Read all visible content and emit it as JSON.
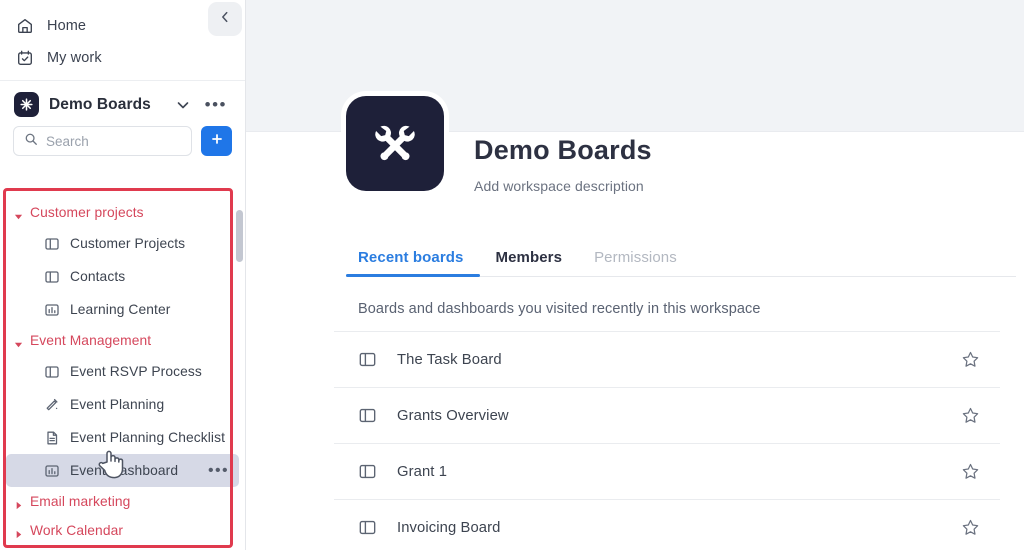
{
  "sidebar": {
    "collapse_label": "chevron-left",
    "nav": [
      {
        "label": "Home",
        "icon": "home-icon"
      },
      {
        "label": "My work",
        "icon": "calendar-check-icon"
      }
    ],
    "workspace": {
      "name": "Demo Boards",
      "caret": "chevron-down-icon",
      "more": "•••"
    },
    "search": {
      "placeholder": "Search",
      "icon": "search-icon"
    },
    "add_button": {
      "label": "+"
    },
    "tree": [
      {
        "type": "folder",
        "label": "Customer projects",
        "expanded": true,
        "highlight": true
      },
      {
        "type": "leaf",
        "label": "Customer Projects",
        "icon": "board-icon"
      },
      {
        "type": "leaf",
        "label": "Contacts",
        "icon": "board-icon"
      },
      {
        "type": "leaf",
        "label": "Learning Center",
        "icon": "dashboard-icon"
      },
      {
        "type": "folder",
        "label": "Event Management",
        "expanded": true,
        "highlight": true
      },
      {
        "type": "leaf",
        "label": "Event RSVP Process",
        "icon": "board-icon"
      },
      {
        "type": "leaf",
        "label": "Event Planning",
        "icon": "workflow-icon"
      },
      {
        "type": "leaf",
        "label": "Event Planning Checklist",
        "icon": "doc-icon"
      },
      {
        "type": "leaf",
        "label": "Event Dashboard",
        "icon": "dashboard-icon",
        "active": true,
        "row_more": "•••"
      },
      {
        "type": "folder",
        "label": "Email marketing",
        "expanded": false,
        "highlight": true
      },
      {
        "type": "folder",
        "label": "Work Calendar",
        "expanded": false,
        "highlight": true
      }
    ]
  },
  "main": {
    "workspace": {
      "title": "Demo Boards",
      "description": "Add workspace description",
      "icon": "crossed-wrenches-icon"
    },
    "tabs": [
      {
        "label": "Recent boards",
        "state": "active"
      },
      {
        "label": "Members",
        "state": "normal"
      },
      {
        "label": "Permissions",
        "state": "muted"
      }
    ],
    "subtitle": "Boards and dashboards you visited recently in this workspace",
    "boards": [
      {
        "name": "The Task Board",
        "icon": "board-icon",
        "star": "star-outline-icon"
      },
      {
        "name": "Grants Overview",
        "icon": "board-icon",
        "star": "star-outline-icon"
      },
      {
        "name": "Grant 1",
        "icon": "board-icon",
        "star": "star-outline-icon"
      },
      {
        "name": "Invoicing Board",
        "icon": "board-icon",
        "star": "star-outline-icon"
      }
    ]
  },
  "annotation": {
    "color": "#e03a4e",
    "shape": "rectangle"
  },
  "colors": {
    "accent_blue": "#1f76e8",
    "tab_blue": "#2b7de0",
    "avatar_navy": "#1e2039",
    "annotation_red": "#e03a4e",
    "folder_red": "#d5475c"
  }
}
